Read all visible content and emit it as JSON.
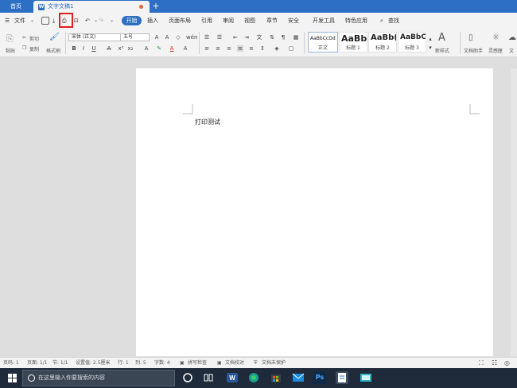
{
  "titlebar": {
    "home_tab": "首页",
    "doc_tab": "文字文稿1",
    "new_tab_symbol": "+"
  },
  "menubar": {
    "file_label": "文件",
    "tabs": [
      "开始",
      "插入",
      "页面布局",
      "引用",
      "审阅",
      "视图",
      "章节",
      "安全",
      "开发工具",
      "特色应用"
    ],
    "search_label": "查找"
  },
  "ribbon": {
    "paste_label": "粘贴",
    "cut_label": "剪切",
    "copy_label": "复制",
    "format_painter_label": "格式刷",
    "font_name": "宋体 (正文)",
    "font_size": "五号",
    "styles": [
      {
        "sample": "AaBbCcDd",
        "caption": "正文"
      },
      {
        "sample": "AaBb",
        "caption": "标题 1"
      },
      {
        "sample": "AaBb(",
        "caption": "标题 2"
      },
      {
        "sample": "AaBbC",
        "caption": "标题 3"
      }
    ],
    "new_style_label": "新样式",
    "doc_assistant_label": "文档助手",
    "inspiration_label": "灵感匣",
    "cloud_label": "文"
  },
  "document": {
    "text": "打印测试"
  },
  "statusbar": {
    "page_num": "页码: 1",
    "pages": "页面: 1/1",
    "section": "节: 1/1",
    "setting": "设置值: 2.5厘米",
    "row": "行: 1",
    "col": "列: 5",
    "words": "字数: 4",
    "spell_check": "拼写检查",
    "doc_proof": "文档校对",
    "doc_protect": "文档未保护"
  },
  "taskbar": {
    "search_placeholder": "在这里输入你要搜索的内容",
    "ps_label": "Ps"
  },
  "colors": {
    "accent": "#2d6fc4",
    "highlight_box": "#e0201c",
    "taskbar": "#1f2b3a"
  }
}
